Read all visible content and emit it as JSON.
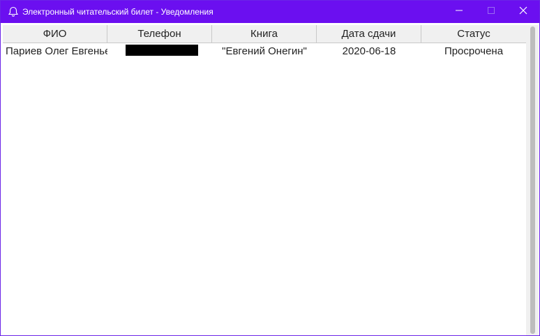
{
  "window": {
    "title": "Электронный читательский билет - Уведомления",
    "app_icon": "bell-icon",
    "accent_color": "#6b0ff0",
    "controls": {
      "minimize_icon": "minimize-icon",
      "maximize_icon": "maximize-icon",
      "close_icon": "close-icon"
    }
  },
  "table": {
    "columns": [
      "ФИО",
      "Телефон",
      "Книга",
      "Дата сдачи",
      "Статус"
    ],
    "rows": [
      {
        "fio": "Париев Олег Евгенье",
        "phone_redacted": true,
        "book": "\"Евгений Онегин\"",
        "due_date": "2020-06-18",
        "status": "Просрочена"
      }
    ]
  }
}
